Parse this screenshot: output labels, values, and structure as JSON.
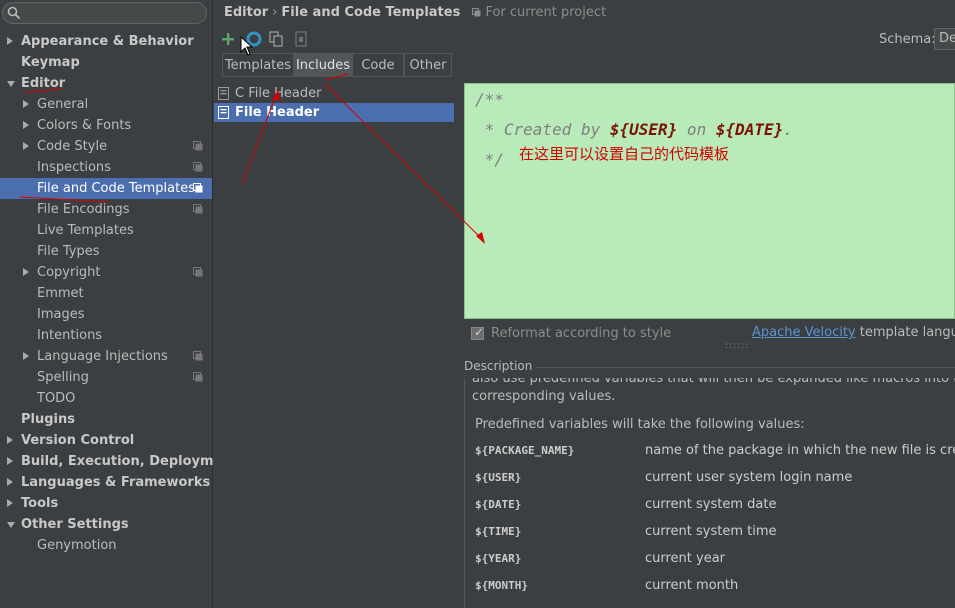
{
  "sidebar": {
    "items": [
      {
        "label": "Appearance & Behavior",
        "level": 0,
        "arrow": "right",
        "bold": true
      },
      {
        "label": "Keymap",
        "level": 0,
        "arrow": "",
        "bold": true
      },
      {
        "label": "Editor",
        "level": 0,
        "arrow": "down",
        "bold": true
      },
      {
        "label": "General",
        "level": 1,
        "arrow": "right"
      },
      {
        "label": "Colors & Fonts",
        "level": 1,
        "arrow": "right"
      },
      {
        "label": "Code Style",
        "level": 1,
        "arrow": "right",
        "project": true
      },
      {
        "label": "Inspections",
        "level": 1,
        "arrow": "",
        "project": true
      },
      {
        "label": "File and Code Templates",
        "level": 1,
        "arrow": "",
        "project": true,
        "selected": true
      },
      {
        "label": "File Encodings",
        "level": 1,
        "arrow": "",
        "project": true
      },
      {
        "label": "Live Templates",
        "level": 1,
        "arrow": ""
      },
      {
        "label": "File Types",
        "level": 1,
        "arrow": ""
      },
      {
        "label": "Copyright",
        "level": 1,
        "arrow": "right",
        "project": true
      },
      {
        "label": "Emmet",
        "level": 1,
        "arrow": ""
      },
      {
        "label": "Images",
        "level": 1,
        "arrow": ""
      },
      {
        "label": "Intentions",
        "level": 1,
        "arrow": ""
      },
      {
        "label": "Language Injections",
        "level": 1,
        "arrow": "right",
        "project": true
      },
      {
        "label": "Spelling",
        "level": 1,
        "arrow": "",
        "project": true
      },
      {
        "label": "TODO",
        "level": 1,
        "arrow": ""
      },
      {
        "label": "Plugins",
        "level": 0,
        "arrow": "",
        "bold": true
      },
      {
        "label": "Version Control",
        "level": 0,
        "arrow": "right",
        "bold": true
      },
      {
        "label": "Build, Execution, Deployment",
        "level": 0,
        "arrow": "right",
        "bold": true
      },
      {
        "label": "Languages & Frameworks",
        "level": 0,
        "arrow": "right",
        "bold": true
      },
      {
        "label": "Tools",
        "level": 0,
        "arrow": "right",
        "bold": true
      },
      {
        "label": "Other Settings",
        "level": 0,
        "arrow": "down",
        "bold": true
      },
      {
        "label": "Genymotion",
        "level": 1,
        "arrow": ""
      }
    ]
  },
  "header": {
    "crumb_editor": "Editor",
    "crumb_sep": "›",
    "crumb_page": "File and Code Templates",
    "scope": "For current project",
    "schema_label": "Schema:",
    "schema_value": "De"
  },
  "tabs": [
    {
      "label": "Templates",
      "active": false
    },
    {
      "label": "Includes",
      "active": true
    },
    {
      "label": "Code",
      "active": false
    },
    {
      "label": "Other",
      "active": false
    }
  ],
  "templates_list": [
    {
      "label": "C File Header",
      "selected": false
    },
    {
      "label": "File Header",
      "selected": true
    }
  ],
  "editor": {
    "line1": "/**",
    "line2_a": " * Created by ",
    "line2_var1": "${USER}",
    "line2_b": " on ",
    "line2_var2": "${DATE}",
    "line2_c": ".",
    "line3": " */",
    "annotation": "在这里可以设置自己的代码模板"
  },
  "reformat": {
    "label": "Reformat according to style",
    "checked": true
  },
  "velocity": {
    "link": "Apache Velocity",
    "rest": " template language"
  },
  "description": {
    "label": "Description",
    "cut_line": "also use predefined variables that will then be expanded like macros into the",
    "cont_line": "corresponding values.",
    "predefined": "Predefined variables will take the following values:",
    "variables": [
      {
        "name": "${PACKAGE_NAME}",
        "desc": "name of the package in which the new file is crea"
      },
      {
        "name": "${USER}",
        "desc": "current user system login name"
      },
      {
        "name": "${DATE}",
        "desc": "current system date"
      },
      {
        "name": "${TIME}",
        "desc": "current system time"
      },
      {
        "name": "${YEAR}",
        "desc": "current year"
      },
      {
        "name": "${MONTH}",
        "desc": "current month"
      }
    ]
  },
  "colors": {
    "selection": "#4b6eaf",
    "editor_bg": "#b9eab9",
    "annotation": "#d40000",
    "link": "#5894d6"
  }
}
